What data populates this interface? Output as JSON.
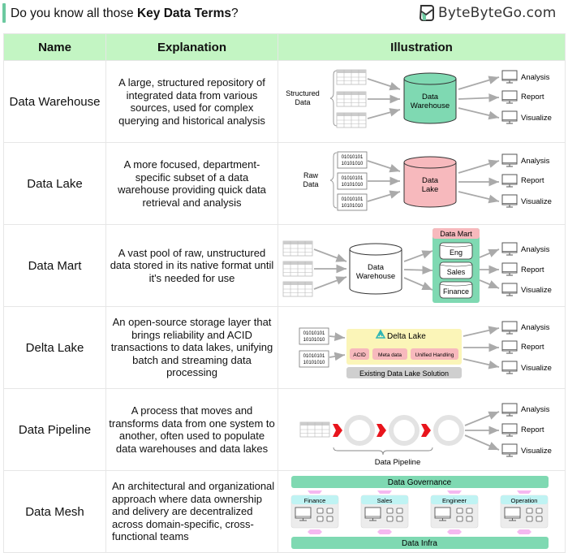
{
  "header": {
    "headline_prefix": "Do you know all those ",
    "headline_bold": "Key Data Terms",
    "headline_suffix": "?",
    "brand": "ByteByteGo.com",
    "accent_color": "#6cc9a0"
  },
  "table": {
    "columns": [
      "Name",
      "Explanation",
      "Illustration"
    ],
    "header_color": "#c3f5c3",
    "rows": [
      {
        "name": "Data Warehouse",
        "explanation": "A large, structured repository of integrated data from various sources, used for complex querying and historical analysis"
      },
      {
        "name": "Data Lake",
        "explanation": "A more focused, department-specific subset of a data warehouse providing quick data retrieval and analysis"
      },
      {
        "name": "Data Mart",
        "explanation": "A vast pool of raw, unstructured data stored in its native format until it's needed for use"
      },
      {
        "name": "Delta Lake",
        "explanation": "An open-source storage layer that brings reliability and ACID transactions to data lakes, unifying batch and streaming data processing"
      },
      {
        "name": "Data Pipeline",
        "explanation": "A process that moves and transforms data from one system to another, often used to populate data warehouses and data lakes"
      },
      {
        "name": "Data Mesh",
        "explanation": "An architectural and organizational approach where data ownership and delivery are decentralized across domain-specific, cross-functional teams"
      }
    ]
  },
  "illustrations": {
    "outputs": [
      "Analysis",
      "Report",
      "Visualize"
    ],
    "binary_line1": "01010101",
    "binary_line2": "10101010",
    "warehouse": {
      "source_label_1": "Structured",
      "source_label_2": "Data",
      "store_line1": "Data",
      "store_line2": "Warehouse",
      "store_color": "#7fd9b2"
    },
    "lake": {
      "source_label_1": "Raw",
      "source_label_2": "Data",
      "store_line1": "Data",
      "store_line2": "Lake",
      "store_color": "#f7b9bd"
    },
    "mart": {
      "store_line1": "Data",
      "store_line2": "Warehouse",
      "mart_title": "Data Mart",
      "marts": [
        "Eng",
        "Sales",
        "Finance"
      ],
      "mart_bg_color": "#7fd9b2",
      "mart_title_color": "#f7b9bd"
    },
    "delta": {
      "title": "Delta Lake",
      "features": [
        "ACID",
        "Meta data",
        "Unified Handling"
      ],
      "base": "Existing Data Lake Solution",
      "box_color": "#fbf5b8",
      "feature_color": "#f7b9bd"
    },
    "pipeline": {
      "label": "Data Pipeline",
      "arrow_color": "#e8141c"
    },
    "mesh": {
      "top": "Data Governance",
      "bottom": "Data Infra",
      "domains": [
        "Finance",
        "Sales",
        "Engineer",
        "Operation"
      ],
      "bar_color": "#7fd9b2",
      "domain_header_color": "#bff3f3",
      "connector_color": "#f5b8f0"
    }
  }
}
